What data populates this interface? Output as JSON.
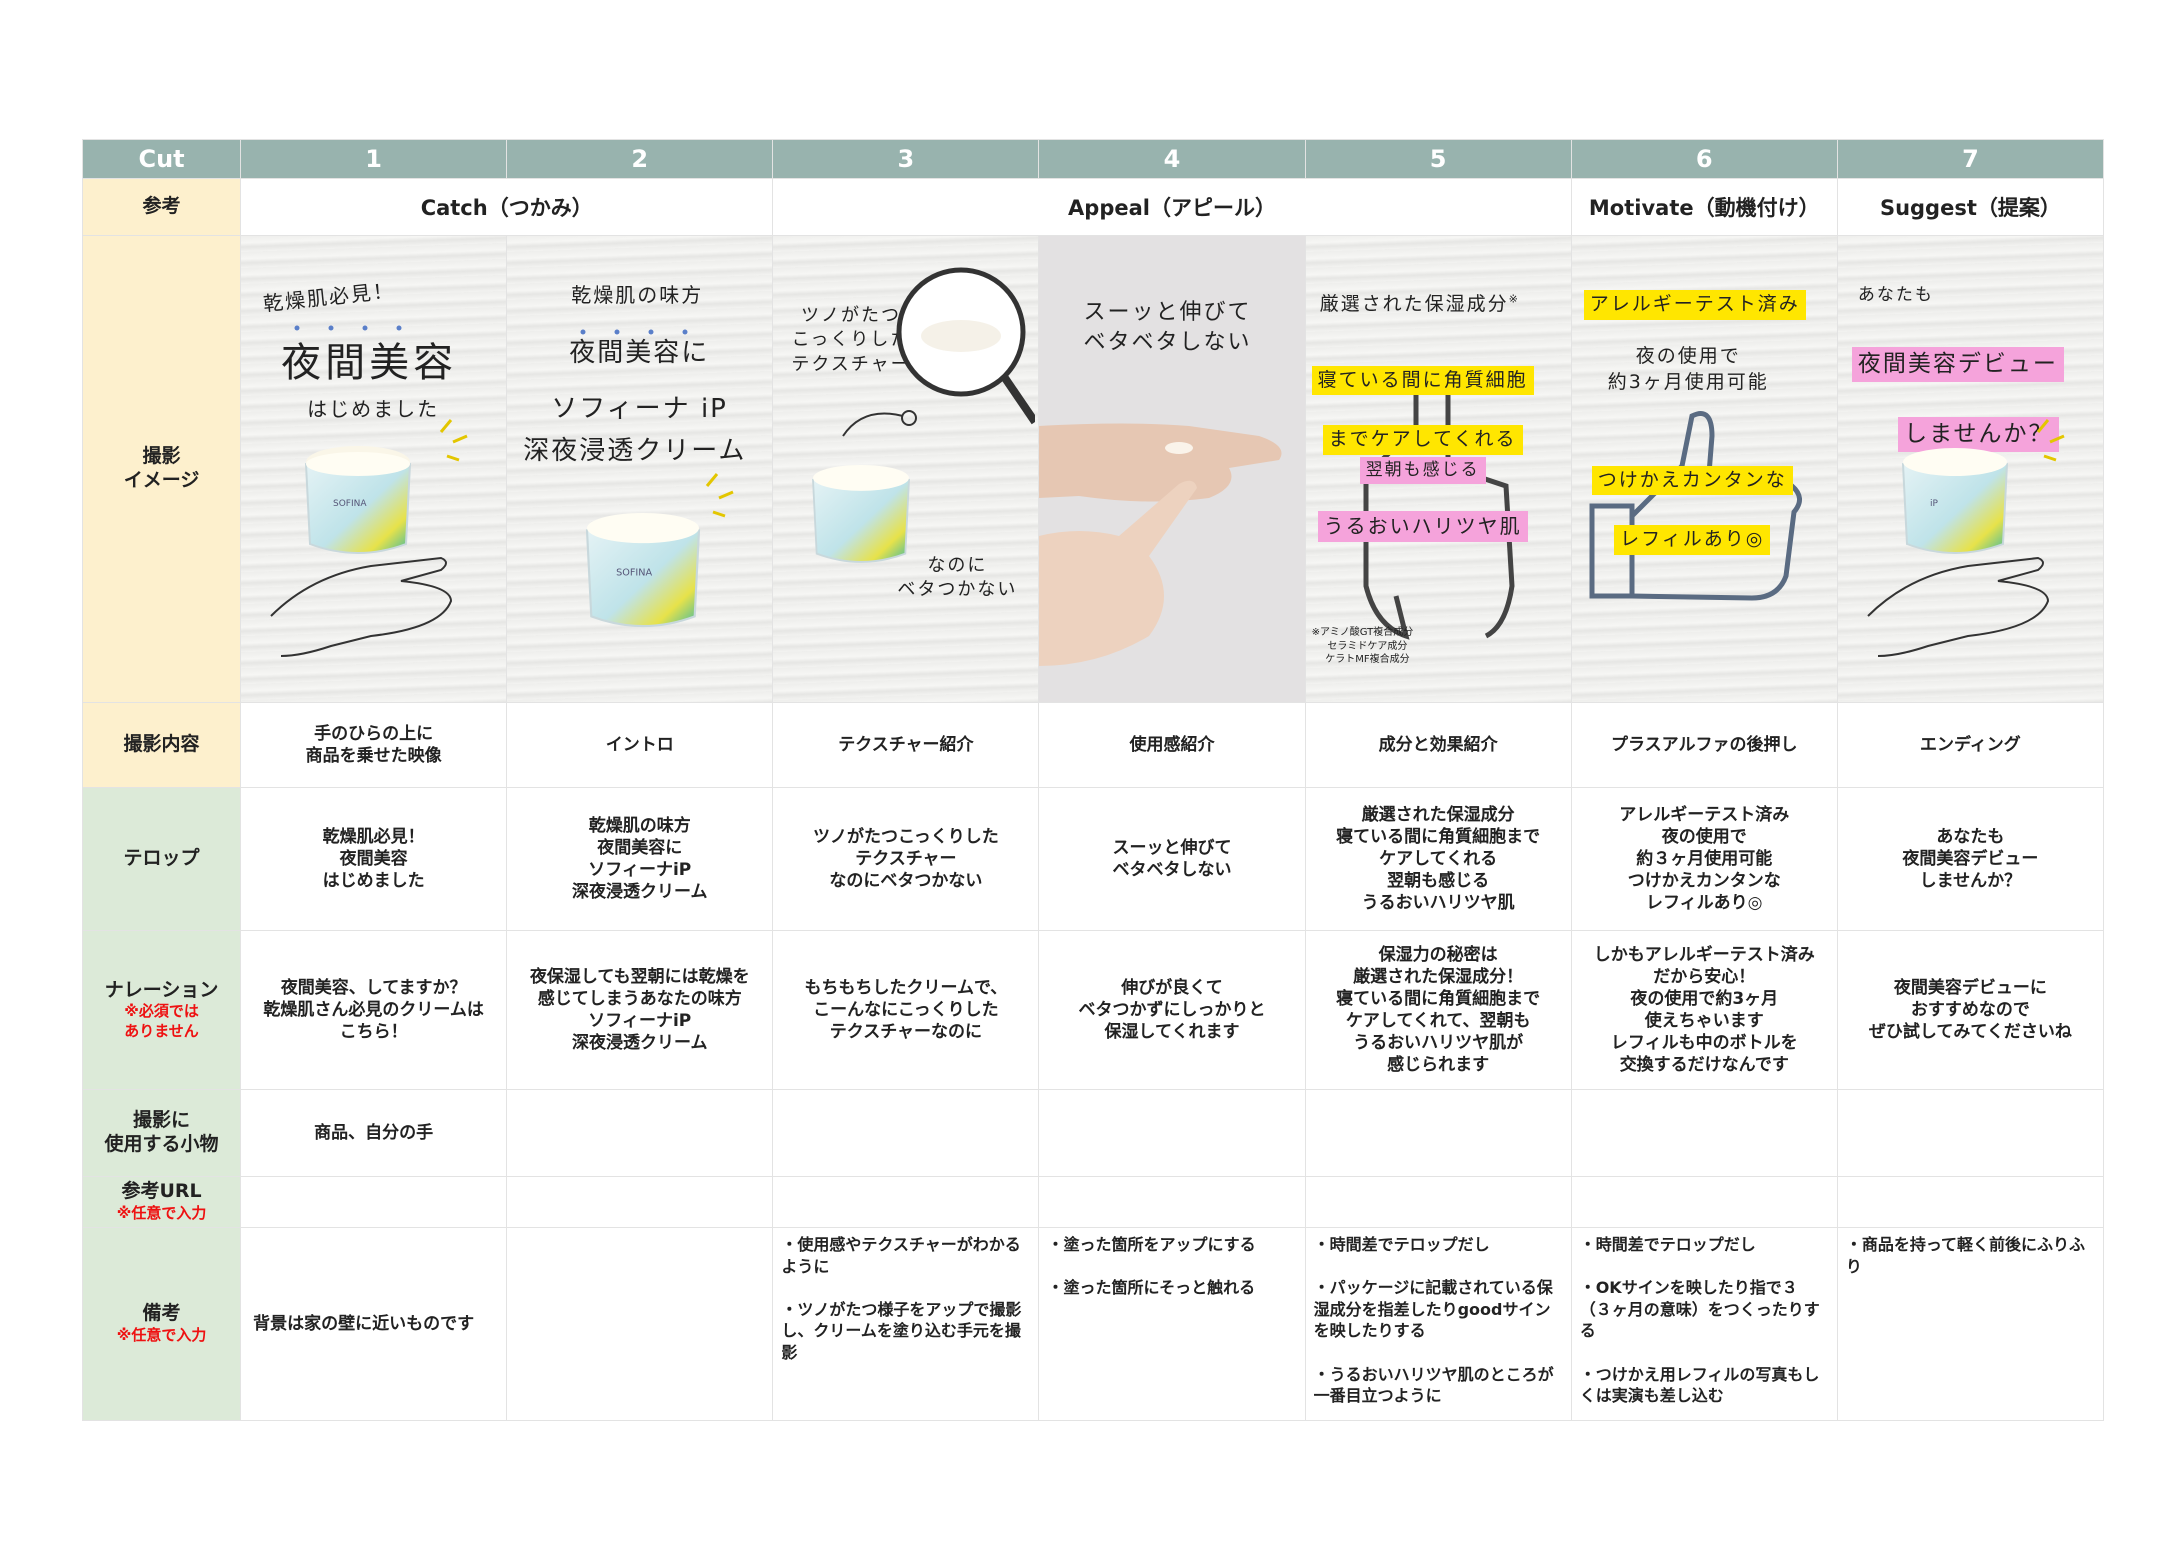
{
  "header": {
    "cut_label": "Cut",
    "cuts": [
      "1",
      "2",
      "3",
      "4",
      "5",
      "6",
      "7"
    ]
  },
  "rows": {
    "reference": "参考",
    "image": "撮影\nイメージ",
    "content": "撮影内容",
    "telop": "テロップ",
    "narration": "ナレーション",
    "narration_note": "※必須では\nありません",
    "props": "撮影に\n使用する小物",
    "url": "参考URL",
    "url_note": "※任意で入力",
    "notes": "備考",
    "notes_note": "※任意で入力"
  },
  "phases": {
    "catch": "Catch（つかみ）",
    "appeal": "Appeal（アピール）",
    "motivate": "Motivate（動機付け）",
    "suggest": "Suggest（提案）"
  },
  "images": {
    "c1": {
      "top": "乾燥肌必見！",
      "main": "夜間美容",
      "sub": "はじめました"
    },
    "c2": {
      "top": "乾燥肌の味方",
      "l1": "夜間美容に",
      "l2": "ソフィーナ iP",
      "l3": "深夜浸透クリーム"
    },
    "c3": {
      "left": "ツノがたつ\nこっくりした\nテクスチャー",
      "right": "なのに\nベタつかない"
    },
    "c4": {
      "text": "スーッと伸びて\nベタベタしない"
    },
    "c5": {
      "top": "厳選された保湿成分",
      "mark": "※",
      "y1": "寝ている間に角質細胞",
      "y2": "までケアしてくれる",
      "p1": "翌朝も感じる",
      "p2": "うるおいハリツヤ肌",
      "foot": "※アミノ酸GT複合成分\n　セラミドケア成分\n　ケラトMF複合成分"
    },
    "c6": {
      "top": "アレルギーテスト済み",
      "mid": "夜の使用で\n約3ヶ月使用可能",
      "y1": "つけかえカンタンな",
      "y2": "レフィルあり◎"
    },
    "c7": {
      "top": "あなたも",
      "p1": "夜間美容デビュー",
      "p2": "しませんか？"
    },
    "brand": "SOFINA",
    "brand_ip": "iP"
  },
  "content": [
    "手のひらの上に\n商品を乗せた映像",
    "イントロ",
    "テクスチャー紹介",
    "使用感紹介",
    "成分と効果紹介",
    "プラスアルファの後押し",
    "エンディング"
  ],
  "telop": [
    "乾燥肌必見！\n夜間美容\nはじめました",
    "乾燥肌の味方\n夜間美容に\nソフィーナiP\n深夜浸透クリーム",
    "ツノがたつこっくりした\nテクスチャー\nなのにベタつかない",
    "スーッと伸びて\nベタベタしない",
    "厳選された保湿成分\n寝ている間に角質細胞まで\nケアしてくれる\n翌朝も感じる\nうるおいハリツヤ肌",
    "アレルギーテスト済み\n夜の使用で\n約３ヶ月使用可能\nつけかえカンタンな\nレフィルあり◎",
    "あなたも\n夜間美容デビュー\nしませんか？"
  ],
  "narration": [
    "夜間美容、してますか？\n乾燥肌さん必見のクリームは\nこちら！",
    "夜保湿しても翌朝には乾燥を\n感じてしまうあなたの味方\nソフィーナiP\n深夜浸透クリーム",
    "もちもちしたクリームで、\nこーんなにこっくりした\nテクスチャーなのに",
    "伸びが良くて\nベタつかずにしっかりと\n保湿してくれます",
    "保湿力の秘密は\n厳選された保湿成分！\n寝ている間に角質細胞まで\nケアしてくれて、翌朝も\nうるおいハリツヤ肌が\n感じられます",
    "しかもアレルギーテスト済み\nだから安心！\n夜の使用で約3ヶ月\n使えちゃいます\nレフィルも中のボトルを\n交換するだけなんです",
    "夜間美容デビューに\nおすすめなので\nぜひ試してみてくださいね"
  ],
  "props": [
    "商品、自分の手",
    "",
    "",
    "",
    "",
    "",
    ""
  ],
  "url": [
    "",
    "",
    "",
    "",
    "",
    "",
    ""
  ],
  "notes": [
    "背景は家の壁に近いものです",
    "",
    "・使用感やテクスチャーがわかるように\n\n・ツノがたつ様子をアップで撮影し、クリームを塗り込む手元を撮影",
    "・塗った箇所をアップにする\n\n・塗った箇所にそっと触れる",
    "・時間差でテロップだし\n\n・パッケージに記載されている保湿成分を指差したりgoodサインを映したりする\n\n・うるおいハリツヤ肌のところが一番目立つように",
    "・時間差でテロップだし\n\n・OKサインを映したり指で３（３ヶ月の意味）をつくったりする\n\n・つけかえ用レフィルの写真もしくは実演も差し込む",
    "・商品を持って軽く前後にふりふり"
  ],
  "colors": {
    "header": "#98b3ae",
    "label_yellow": "#fdf0cd",
    "label_green": "#dcead8",
    "required_red": "#e11111",
    "highlight_yellow": "#ffe600",
    "highlight_pink": "#f5a3db"
  }
}
